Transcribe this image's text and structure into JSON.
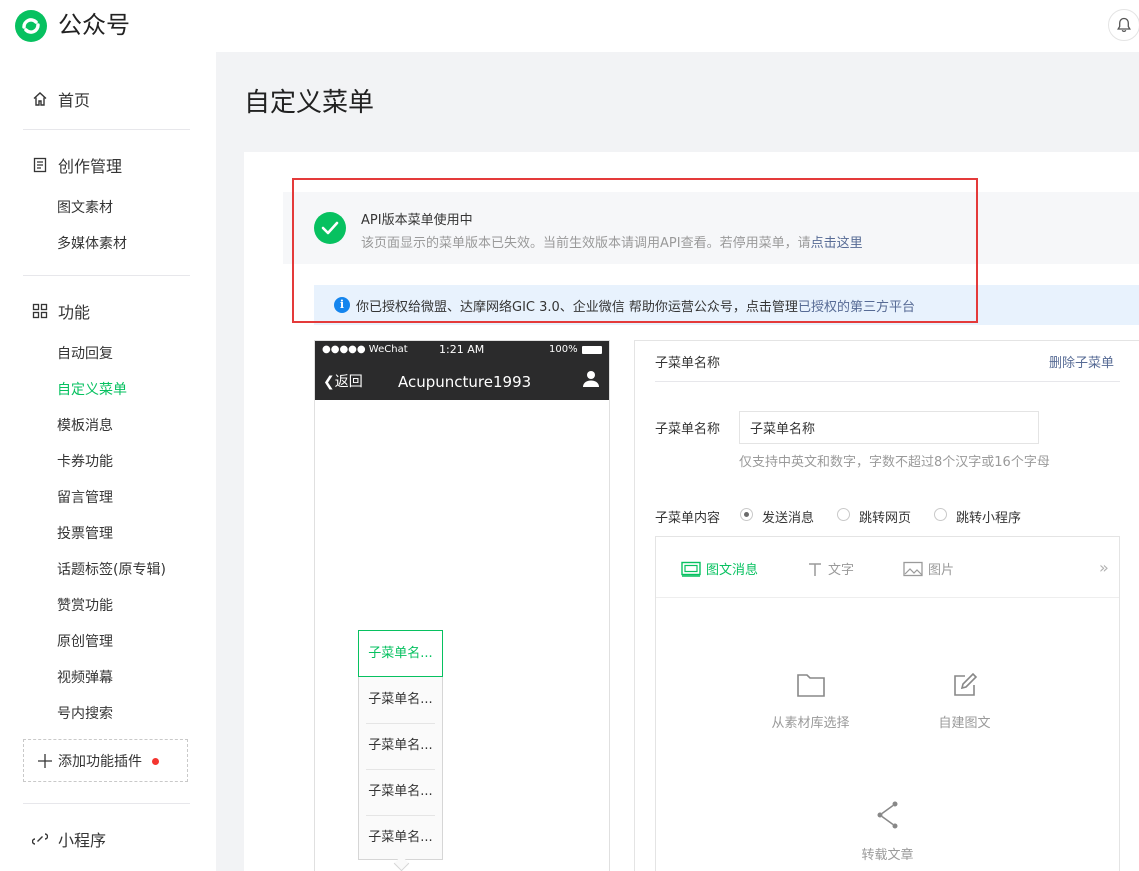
{
  "app": {
    "brand": "公众号"
  },
  "sidebar": {
    "home": "首页",
    "creation": {
      "label": "创作管理",
      "items": [
        "图文素材",
        "多媒体素材"
      ]
    },
    "features": {
      "label": "功能",
      "items": [
        "自动回复",
        "自定义菜单",
        "模板消息",
        "卡券功能",
        "留言管理",
        "投票管理",
        "话题标签(原专辑)",
        "赞赏功能",
        "原创管理",
        "视频弹幕",
        "号内搜索"
      ],
      "active_index": 1
    },
    "add_plugin": "添加功能插件",
    "mini_program": "小程序"
  },
  "page": {
    "title": "自定义菜单"
  },
  "api_notice": {
    "title": "API版本菜单使用中",
    "desc": "该页面显示的菜单版本已失效。当前生效版本请调用API查看。若停用菜单，请",
    "link": "点击这里"
  },
  "info_bar": {
    "text": "你已授权给微盟、达摩网络GIC 3.0、企业微信  帮助你运营公众号，点击管理",
    "link": "已授权的第三方平台"
  },
  "phone": {
    "carrier": "●●●●● WeChat",
    "time": "1:21 AM",
    "battery": "100%",
    "back": "返回",
    "account": "Acupuncture1993",
    "submenu": [
      "子菜单名...",
      "子菜单名...",
      "子菜单名...",
      "子菜单名...",
      "子菜单名..."
    ]
  },
  "editor": {
    "header_title": "子菜单名称",
    "delete": "删除子菜单",
    "name_label": "子菜单名称",
    "name_value": "子菜单名称",
    "name_hint": "仅支持中英文和数字，字数不超过8个汉字或16个字母",
    "content_label": "子菜单内容",
    "radios": [
      "发送消息",
      "跳转网页",
      "跳转小程序"
    ],
    "radio_selected": 0,
    "tabs": [
      "图文消息",
      "文字",
      "图片"
    ],
    "more": "»",
    "actions": {
      "library": "从素材库选择",
      "create": "自建图文",
      "repost": "转载文章"
    }
  },
  "colors": {
    "accent": "#07c160",
    "link": "#576b95",
    "highlight_box": "#e43a3a"
  }
}
